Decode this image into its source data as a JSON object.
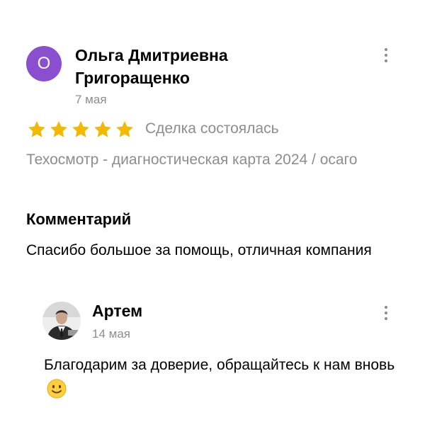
{
  "review": {
    "avatar_letter": "О",
    "author_name": "Ольга Дмитриевна Григоращенко",
    "date": "7 мая",
    "rating": 5,
    "rating_max": 5,
    "star_color": "#f5b800",
    "avatar_color": "#8a4fcf",
    "deal_status": "Сделка состоялась",
    "service": "Техосмотр - диагностическая карта 2024 / осаго",
    "comment_heading": "Комментарий",
    "comment_text": "Спасибо большое за помощь, отличная компания"
  },
  "reply": {
    "author_name": "Артем",
    "date": "14 мая",
    "text": "Благодарим за доверие, обращайтесь к нам вновь",
    "emoji_icon": "slightly-smiling-face-icon"
  },
  "icons": {
    "more": "more-vertical-icon",
    "star": "star-icon"
  }
}
